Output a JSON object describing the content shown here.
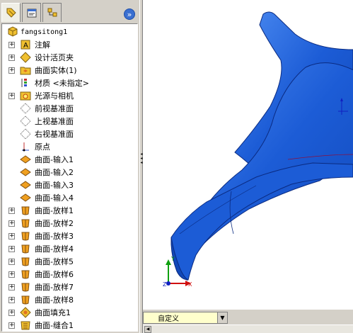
{
  "tabs": [
    {
      "name": "feature-manager-tab",
      "icon": "feature-tree-icon"
    },
    {
      "name": "property-manager-tab",
      "icon": "property-manager-icon"
    },
    {
      "name": "configuration-manager-tab",
      "icon": "configuration-icon"
    }
  ],
  "collapse_glyph": "»",
  "tree": {
    "root": {
      "label": "fangsitong1",
      "icon": "part-icon"
    },
    "items": [
      {
        "label": "注解",
        "icon": "annotations-icon",
        "expandable": true
      },
      {
        "label": "设计活页夹",
        "icon": "design-binder-icon",
        "expandable": true
      },
      {
        "label": "曲面实体(1)",
        "icon": "surface-bodies-folder-icon",
        "expandable": true
      },
      {
        "label": "材质 <未指定>",
        "icon": "material-icon",
        "expandable": false
      },
      {
        "label": "光源与相机",
        "icon": "lights-cameras-icon",
        "expandable": true
      },
      {
        "label": "前视基准面",
        "icon": "plane-icon",
        "expandable": false
      },
      {
        "label": "上视基准面",
        "icon": "plane-icon",
        "expandable": false
      },
      {
        "label": "右视基准面",
        "icon": "plane-icon",
        "expandable": false
      },
      {
        "label": "原点",
        "icon": "origin-icon",
        "expandable": false
      },
      {
        "label": "曲面-输入1",
        "icon": "imported-surface-icon",
        "expandable": false
      },
      {
        "label": "曲面-输入2",
        "icon": "imported-surface-icon",
        "expandable": false
      },
      {
        "label": "曲面-输入3",
        "icon": "imported-surface-icon",
        "expandable": false
      },
      {
        "label": "曲面-输入4",
        "icon": "imported-surface-icon",
        "expandable": false
      },
      {
        "label": "曲面-放样1",
        "icon": "loft-surface-icon",
        "expandable": true
      },
      {
        "label": "曲面-放样2",
        "icon": "loft-surface-icon",
        "expandable": true
      },
      {
        "label": "曲面-放样3",
        "icon": "loft-surface-icon",
        "expandable": true
      },
      {
        "label": "曲面-放样4",
        "icon": "loft-surface-icon",
        "expandable": true
      },
      {
        "label": "曲面-放样5",
        "icon": "loft-surface-icon",
        "expandable": true
      },
      {
        "label": "曲面-放样6",
        "icon": "loft-surface-icon",
        "expandable": true
      },
      {
        "label": "曲面-放样7",
        "icon": "loft-surface-icon",
        "expandable": true
      },
      {
        "label": "曲面-放样8",
        "icon": "loft-surface-icon",
        "expandable": true
      },
      {
        "label": "曲面填充1",
        "icon": "fill-surface-icon",
        "expandable": true
      },
      {
        "label": "曲面-缝合1",
        "icon": "knit-surface-icon",
        "expandable": true
      }
    ]
  },
  "view": {
    "dropdown_value": "自定义",
    "triad": {
      "x": "X",
      "y": "Y",
      "z": "Z"
    }
  },
  "colors": {
    "model_fill": "#1c5cd6",
    "model_edge": "#0a2a80",
    "model_highlight": "#4d8cf2",
    "triad_x": "#d01010",
    "triad_y": "#10a010",
    "triad_z": "#1020c0"
  }
}
